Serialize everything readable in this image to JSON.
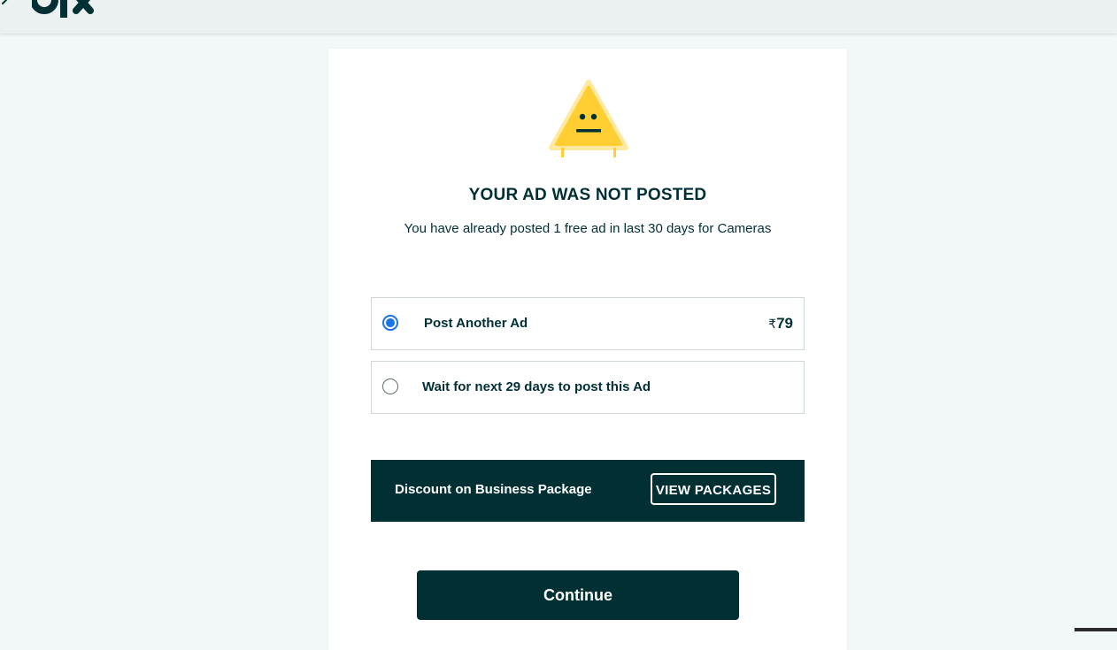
{
  "header": {
    "logo_icon": "olx-logo",
    "back_icon": "back-arrow-icon"
  },
  "dialog": {
    "illustration_icon": "warning-triangle-face-icon",
    "title": "YOUR AD WAS NOT POSTED",
    "message": "You have already posted 1 free ad in last 30 days for Cameras",
    "options": [
      {
        "label": "Post Another Ad",
        "currency": "₹",
        "price": "79",
        "selected": true
      },
      {
        "label": "Wait for next 29 days to post this Ad",
        "selected": false
      }
    ],
    "discount": {
      "text": "Discount on Business Package",
      "button_label": "VIEW PACKAGES"
    },
    "continue_label": "Continue"
  },
  "colors": {
    "brand_dark": "#002f34",
    "warning_yellow": "#ffce32",
    "radio_selected": "#1a73e8",
    "page_background": "#f2f8f7"
  }
}
